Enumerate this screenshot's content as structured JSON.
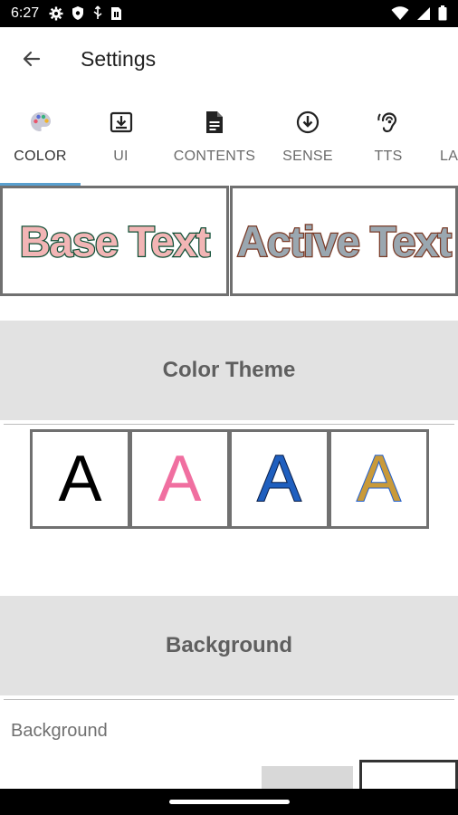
{
  "status_bar": {
    "time": "6:27",
    "left_icons": [
      "gear-icon",
      "shield-icon",
      "usb-icon",
      "sim-card-icon"
    ],
    "right_icons": [
      "wifi-icon",
      "signal-icon",
      "battery-icon"
    ]
  },
  "app_bar": {
    "title": "Settings",
    "back_icon": "arrow-back-icon"
  },
  "tabs": {
    "active_index": 0,
    "accent_color": "#5aa0cf",
    "items": [
      {
        "label": "COLOR",
        "icon": "palette-icon"
      },
      {
        "label": "UI",
        "icon": "download-box-icon"
      },
      {
        "label": "CONTENTS",
        "icon": "document-icon"
      },
      {
        "label": "SENSE",
        "icon": "arrow-down-circle-icon"
      },
      {
        "label": "TTS",
        "icon": "hearing-icon"
      },
      {
        "label": "LA",
        "icon": ""
      }
    ]
  },
  "preview": {
    "base_text": "Base Text",
    "active_text": "Active Text",
    "base_fill": "#f2b5b5",
    "base_stroke": "#0f4f35",
    "active_fill": "#9aa7b0",
    "active_stroke": "#7a3b27"
  },
  "color_theme": {
    "header": "Color Theme",
    "swatches": [
      {
        "letter": "A",
        "fill": "#000000",
        "stroke": "none"
      },
      {
        "letter": "A",
        "fill": "#f06fa0",
        "stroke": "none"
      },
      {
        "letter": "A",
        "fill": "#1f5fbf",
        "stroke": "#0a1f4a"
      },
      {
        "letter": "A",
        "fill": "#c99a3a",
        "stroke": "#1f5fd0"
      }
    ]
  },
  "background": {
    "header": "Background",
    "label": "Background",
    "swatch_colors": [
      "#d8d8d8",
      "#ffffff"
    ]
  }
}
